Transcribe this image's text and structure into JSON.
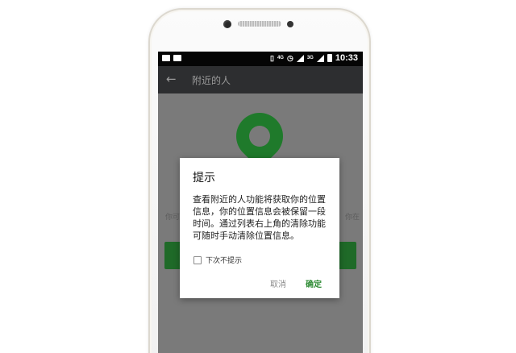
{
  "status_bar": {
    "time": "10:33",
    "network_label": "4G",
    "network_label_2": "3G",
    "icons": [
      "chat-notification-icon",
      "image-notification-icon",
      "vibrate-icon",
      "alarm-icon",
      "signal-icon",
      "battery-icon"
    ]
  },
  "titlebar": {
    "back_glyph": "←",
    "title": "附近的人"
  },
  "background": {
    "left_fragment": "你可",
    "right_fragment": "你在"
  },
  "dialog": {
    "title": "提示",
    "message": "查看附近的人功能将获取你的位置信息，你的位置信息会被保留一段时间。通过列表右上角的清除功能可随时手动清除位置信息。",
    "checkbox_label": "下次不提示",
    "checkbox_checked": false,
    "cancel_label": "取消",
    "ok_label": "确定"
  },
  "colors": {
    "accent_green": "#2e8b34",
    "pin_green": "#1f7a2b",
    "overlay_gray": "#7a7a7a",
    "titlebar_dark": "#2d2e30"
  }
}
